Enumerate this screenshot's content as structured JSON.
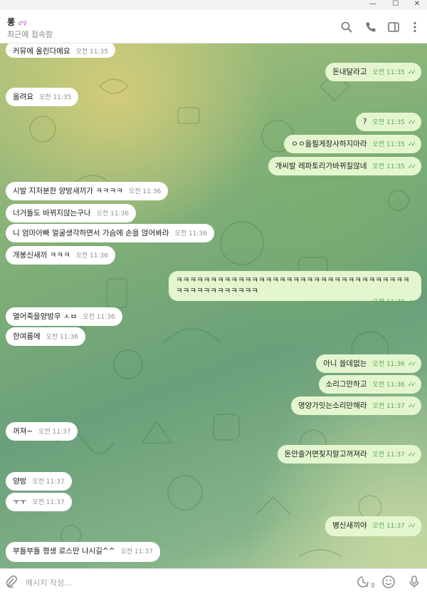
{
  "window": {
    "minimize": "—",
    "maximize": "☐",
    "close": "✕"
  },
  "header": {
    "name": "롱",
    "name_badge": "♂♀",
    "status": "최근에 접속함",
    "icons": [
      "search-icon",
      "phone-icon",
      "sidebar-icon",
      "more-icon"
    ]
  },
  "messages": [
    {
      "dir": "in",
      "text": "커뮤에 올린다메요",
      "time": "오전 11:35"
    },
    {
      "dir": "out",
      "text": "돈내달라고",
      "time": "오전 11:35",
      "check": "✓✓"
    },
    {
      "dir": "in",
      "text": "올려요",
      "time": "오전 11:35"
    },
    {
      "dir": "out",
      "text": "?",
      "time": "오전 11:35",
      "check": "✓✓"
    },
    {
      "dir": "out",
      "text": "ㅇㅇ올필게장사하지마라",
      "time": "오전 11:35",
      "check": "✓✓"
    },
    {
      "dir": "out",
      "text": "개씨발 레파토리가바뀌질않네",
      "time": "오전 11:35",
      "check": "✓✓"
    },
    {
      "dir": "in",
      "text": "시발 지저분한 양방새끼가 ㅋㅋㅋㅋ",
      "time": "오전 11:36"
    },
    {
      "dir": "in",
      "text": "너거들도 바뀌지않는구나",
      "time": "오전 11:36"
    },
    {
      "dir": "in",
      "text": "니 엄마아빠 얼굴생각하면서 가슴에 손을 얹어봐라",
      "time": "오전 11:36"
    },
    {
      "dir": "in",
      "text": "개봉신새끼 ㅋㅋㅋ",
      "time": "오전 11:36"
    },
    {
      "dir": "out",
      "text": "ㅋㅋㅋㅋㅋㅋㅋㅋㅋㅋㅋㅋㅋㅋㅋㅋㅋㅋㅋㅋㅋㅋㅋㅋㅋㅋㅋㅋㅋㅋㅋㅋㅋㅋㅋㅋㅋㅋㅋㅋㅋㅋㅋㅋㅋㅋ",
      "time": "오전 11:36",
      "check": "✓✓"
    },
    {
      "dir": "in",
      "text": "열어죽을양방우 ㅅㅂ",
      "time": "오전 11:36"
    },
    {
      "dir": "in",
      "text": "한여름에",
      "time": "오전 11:36"
    },
    {
      "dir": "out",
      "text": "아니 쓸데없는",
      "time": "오전 11:36",
      "check": "✓✓"
    },
    {
      "dir": "out",
      "text": "소리그만하고",
      "time": "오전 11:36",
      "check": "✓✓"
    },
    {
      "dir": "out",
      "text": "영양가잇는소리만해라",
      "time": "오전 11:37",
      "check": "✓✓"
    },
    {
      "dir": "in",
      "text": "꺼져~",
      "time": "오전 11:37"
    },
    {
      "dir": "out",
      "text": "돈안줄거면짖지말고꺼져라",
      "time": "오전 11:37",
      "check": "✓✓"
    },
    {
      "dir": "in",
      "text": "양방",
      "time": "오전 11:37"
    },
    {
      "dir": "in",
      "text": "ㅜㅜ",
      "time": "오전 11:37"
    },
    {
      "dir": "out",
      "text": "병신새끼야",
      "time": "오전 11:37",
      "check": "✓✓"
    },
    {
      "dir": "in",
      "text": "부들부들 평생 로스만 나시길^^",
      "time": "오전 11:37"
    }
  ],
  "input": {
    "placeholder": "메시지 작성...",
    "value": "",
    "icons": [
      "attach-icon",
      "gif-icon",
      "emoji-icon",
      "microphone-icon"
    ],
    "gif_label": "1 별"
  },
  "colors": {
    "incoming_bubble": "#ffffff",
    "outgoing_bubble": "#e4f6cf",
    "timestamp_out": "#5ea654",
    "check": "#4fa64a"
  }
}
